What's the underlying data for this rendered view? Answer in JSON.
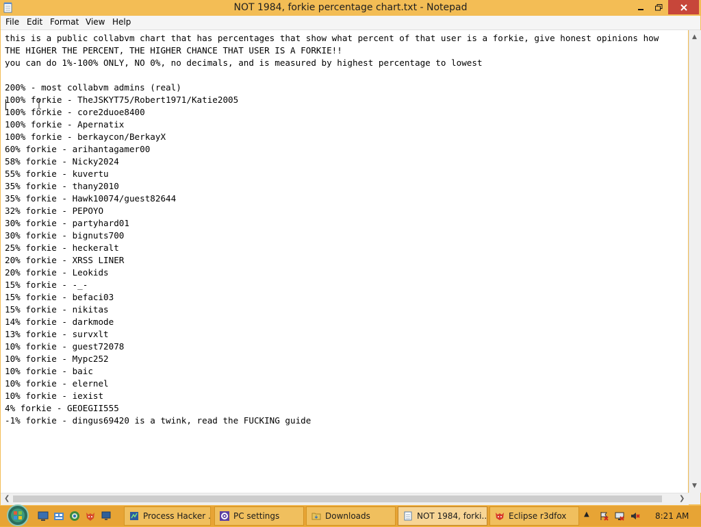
{
  "window": {
    "title": "NOT 1984, forkie percentage chart.txt - Notepad"
  },
  "menu": [
    "File",
    "Edit",
    "Format",
    "View",
    "Help"
  ],
  "document_lines": [
    "this is a public collabvm chart that has percentages that show what percent of that user is a forkie, give honest opinions how",
    "THE HIGHER THE PERCENT, THE HIGHER CHANCE THAT USER IS A FORKIE!!",
    "you can do 1%-100% ONLY, NO 0%, no decimals, and is measured by highest percentage to lowest",
    "",
    "200% - most collabvm admins (real)",
    "100% forkie - TheJSKYT75/Robert1971/Katie2005",
    "100% forkie - core2duoe8400",
    "100% forkie - Apernatix",
    "100% forkie - berkaycon/BerkayX",
    "60% forkie - arihantagamer00",
    "58% forkie - Nicky2024",
    "55% forkie - kuvertu",
    "35% forkie - thany2010",
    "35% forkie - Hawk10074/guest82644",
    "32% forkie - PEPOYO",
    "30% forkie - partyhard01",
    "30% forkie - bignuts700",
    "25% forkie - heckeralt",
    "20% forkie - XRSS LINER",
    "20% forkie - Leokids",
    "15% forkie - -_-",
    "15% forkie - befaci03",
    "15% forkie - nikitas",
    "14% forkie - darkmode",
    "13% forkie - survxlt",
    "10% forkie - guest72078",
    "10% forkie - Mypc252",
    "10% forkie - baic",
    "10% forkie - elernel",
    "10% forkie - iexist",
    "4% forkie - GEOEGII555",
    "-1% forkie - dingus69420 is a twink, read the FUCKING guide"
  ],
  "taskbar": {
    "tasks": [
      {
        "label": "Process Hacker ...",
        "icon": "process-hacker-icon"
      },
      {
        "label": "PC settings",
        "icon": "gear-icon"
      },
      {
        "label": "Downloads",
        "icon": "folder-icon"
      },
      {
        "label": "NOT 1984, forki...",
        "icon": "notepad-icon"
      },
      {
        "label": "Eclipse r3dfox",
        "icon": "fox-icon"
      }
    ],
    "clock": "8:21 AM"
  },
  "colors": {
    "accent": "#f3bd55",
    "taskbar": "#e7a435",
    "close": "#c7463a"
  }
}
